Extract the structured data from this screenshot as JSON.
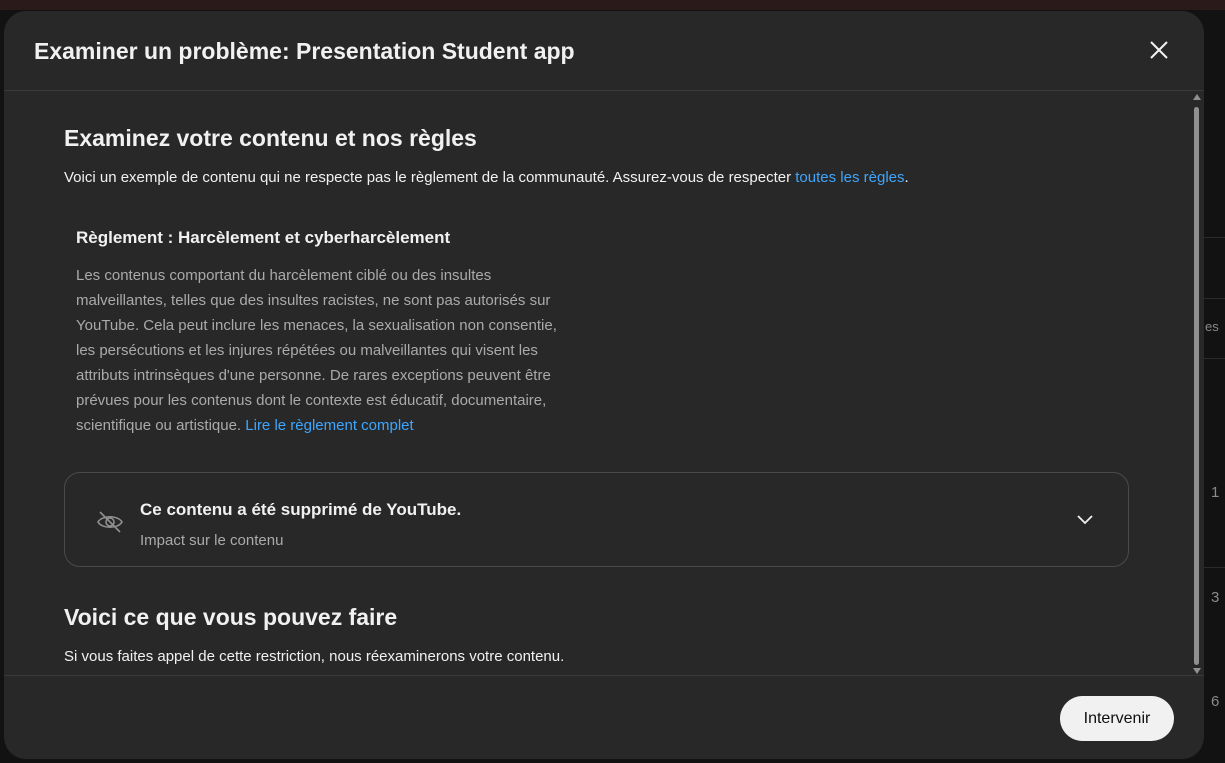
{
  "background": {
    "peek_texts": [
      "es",
      "1",
      "3",
      "6"
    ]
  },
  "dialog": {
    "title": "Examiner un problème: Presentation Student app",
    "close_icon": "close-icon"
  },
  "review": {
    "heading": "Examinez votre contenu et nos règles",
    "intro": "Voici un exemple de contenu qui ne respecte pas le règlement de la communauté. Assurez-vous de respecter ",
    "intro_link": "toutes les règles",
    "intro_end": "."
  },
  "policy": {
    "title": "Règlement : Harcèlement et cyberharcèlement",
    "lines": [
      "Les contenus comportant du harcèlement ciblé ou des insultes",
      "malveillantes, telles que des insultes racistes, ne sont pas autorisés sur",
      "YouTube. Cela peut inclure les menaces, la sexualisation non consentie,",
      "les persécutions et les injures répétées ou malveillantes qui visent les",
      "attributs intrinsèques d'une personne. De rares exceptions peuvent être",
      "prévues pour les contenus dont le contexte est éducatif, documentaire,"
    ],
    "last_line": "scientifique ou artistique. ",
    "read_more_link": "Lire le règlement complet"
  },
  "impact": {
    "icon": "eye-off-icon",
    "title": "Ce contenu a été supprimé de YouTube.",
    "subtitle": "Impact sur le contenu",
    "expand_icon": "chevron-down-icon"
  },
  "options": {
    "heading": "Voici ce que vous pouvez faire",
    "text": "Si vous faites appel de cette restriction, nous réexaminerons votre contenu."
  },
  "footer": {
    "action_label": "Intervenir"
  },
  "colors": {
    "dialog_bg": "#282828",
    "link": "#3ea6ff",
    "primary_text": "#f1f1f1",
    "secondary_text": "#aaaaaa",
    "button_bg": "#f1f1f1"
  }
}
